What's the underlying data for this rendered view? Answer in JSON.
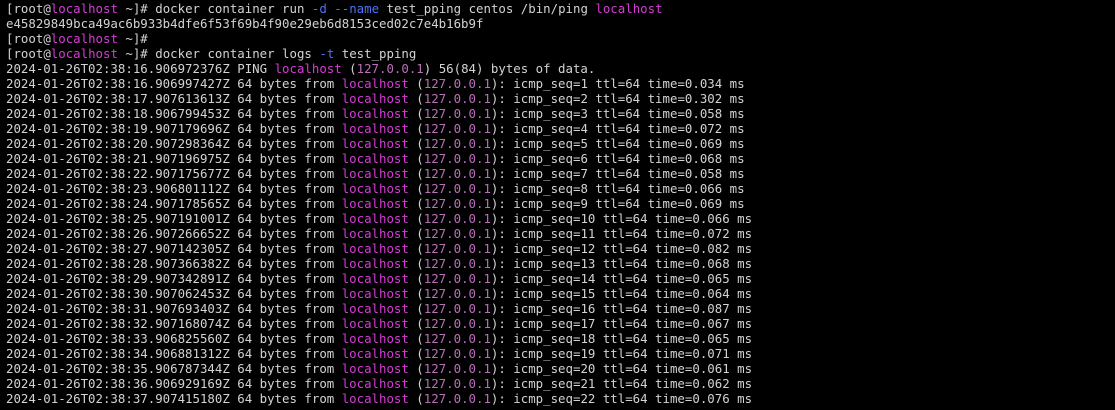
{
  "prompt": {
    "user": "root",
    "at": "@",
    "host": "localhost",
    "dir": " ~]# "
  },
  "commands": {
    "run": {
      "prefix": "docker container run ",
      "opt1": "-d",
      "space": " ",
      "opt2": "--name",
      "mid": " test_pping centos /bin/ping ",
      "host": "localhost"
    },
    "container_id": "e45829849bca49ac6b933b4dfe6f53f69b4f90e29eb6d8153ced02c7e4b16b9f",
    "logs": {
      "prefix": "docker container logs ",
      "opt": "-t",
      "suffix": " test_pping"
    }
  },
  "ping_header": {
    "timestamp": "2024-01-26T02:38:16.906972376Z",
    "pre": " PING ",
    "host": "localhost",
    "ip_open": " (",
    "ip": "127.0.0.1",
    "ip_close": ")",
    "post": " 56(84) bytes of data."
  },
  "ping_lines": [
    {
      "ts": "2024-01-26T02:38:16.906997427Z",
      "seq": "1",
      "ttl": "64",
      "time": "0.034"
    },
    {
      "ts": "2024-01-26T02:38:17.907613613Z",
      "seq": "2",
      "ttl": "64",
      "time": "0.302"
    },
    {
      "ts": "2024-01-26T02:38:18.906799453Z",
      "seq": "3",
      "ttl": "64",
      "time": "0.058"
    },
    {
      "ts": "2024-01-26T02:38:19.907179696Z",
      "seq": "4",
      "ttl": "64",
      "time": "0.072"
    },
    {
      "ts": "2024-01-26T02:38:20.907298364Z",
      "seq": "5",
      "ttl": "64",
      "time": "0.069"
    },
    {
      "ts": "2024-01-26T02:38:21.907196975Z",
      "seq": "6",
      "ttl": "64",
      "time": "0.068"
    },
    {
      "ts": "2024-01-26T02:38:22.907175677Z",
      "seq": "7",
      "ttl": "64",
      "time": "0.058"
    },
    {
      "ts": "2024-01-26T02:38:23.906801112Z",
      "seq": "8",
      "ttl": "64",
      "time": "0.066"
    },
    {
      "ts": "2024-01-26T02:38:24.907178565Z",
      "seq": "9",
      "ttl": "64",
      "time": "0.069"
    },
    {
      "ts": "2024-01-26T02:38:25.907191001Z",
      "seq": "10",
      "ttl": "64",
      "time": "0.066"
    },
    {
      "ts": "2024-01-26T02:38:26.907266652Z",
      "seq": "11",
      "ttl": "64",
      "time": "0.072"
    },
    {
      "ts": "2024-01-26T02:38:27.907142305Z",
      "seq": "12",
      "ttl": "64",
      "time": "0.082"
    },
    {
      "ts": "2024-01-26T02:38:28.907366382Z",
      "seq": "13",
      "ttl": "64",
      "time": "0.068"
    },
    {
      "ts": "2024-01-26T02:38:29.907342891Z",
      "seq": "14",
      "ttl": "64",
      "time": "0.065"
    },
    {
      "ts": "2024-01-26T02:38:30.907062453Z",
      "seq": "15",
      "ttl": "64",
      "time": "0.064"
    },
    {
      "ts": "2024-01-26T02:38:31.907693403Z",
      "seq": "16",
      "ttl": "64",
      "time": "0.087"
    },
    {
      "ts": "2024-01-26T02:38:32.907168074Z",
      "seq": "17",
      "ttl": "64",
      "time": "0.067"
    },
    {
      "ts": "2024-01-26T02:38:33.906825560Z",
      "seq": "18",
      "ttl": "64",
      "time": "0.065"
    },
    {
      "ts": "2024-01-26T02:38:34.906881312Z",
      "seq": "19",
      "ttl": "64",
      "time": "0.071"
    },
    {
      "ts": "2024-01-26T02:38:35.906787344Z",
      "seq": "20",
      "ttl": "64",
      "time": "0.061"
    },
    {
      "ts": "2024-01-26T02:38:36.906929169Z",
      "seq": "21",
      "ttl": "64",
      "time": "0.062"
    },
    {
      "ts": "2024-01-26T02:38:37.907415180Z",
      "seq": "22",
      "ttl": "64",
      "time": "0.076"
    }
  ],
  "ping_fmt": {
    "bytes": " 64 bytes from ",
    "host": "localhost",
    "ip_open": " (",
    "ip": "127.0.0.1",
    "ip_close": "): ",
    "seq_label": "icmp_seq=",
    "ttl_label": " ttl=",
    "time_label": " time=",
    "unit": " ms"
  },
  "colors": {
    "background": "#000000",
    "foreground": "#d3d3d3",
    "hostname": "#d63bd6",
    "option": "#4e74f2",
    "ip": "#b96fb9"
  }
}
